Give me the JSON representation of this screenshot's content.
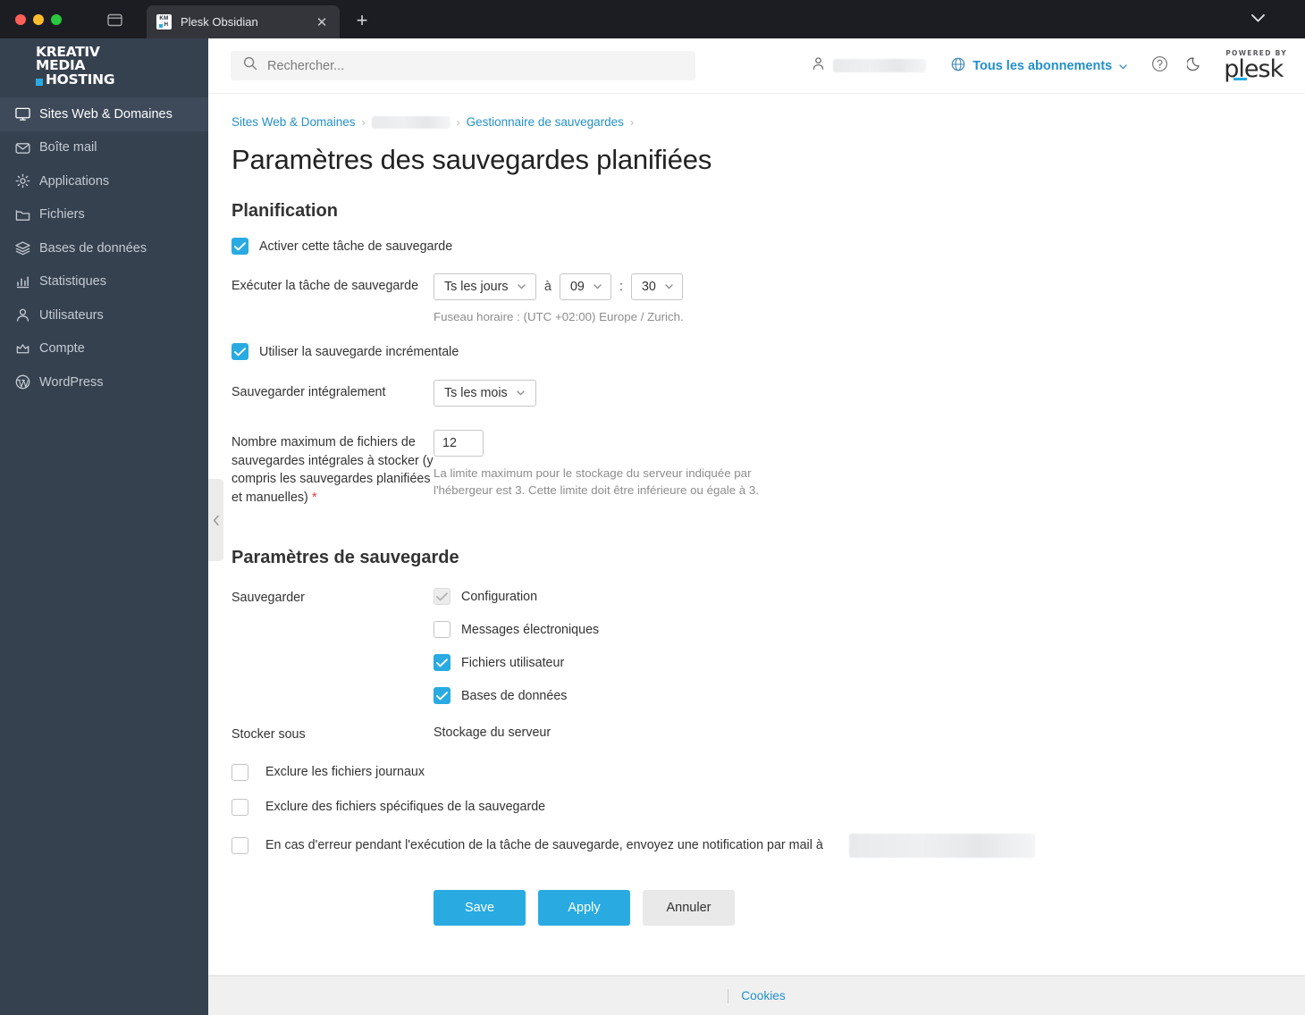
{
  "browser": {
    "tab_title": "Plesk Obsidian",
    "tab_favicon_top": "KM",
    "tab_favicon_bottom": "H",
    "close_glyph": "✕",
    "newtab_glyph": "+"
  },
  "sidebar": {
    "brand": {
      "line1": "KREATIV",
      "line2": "MEDIA",
      "line3": "HOSTING"
    },
    "items": [
      {
        "label": "Sites Web & Domaines",
        "icon": "monitor-icon",
        "active": true
      },
      {
        "label": "Boîte mail",
        "icon": "mail-icon",
        "active": false
      },
      {
        "label": "Applications",
        "icon": "gear-icon",
        "active": false
      },
      {
        "label": "Fichiers",
        "icon": "folder-icon",
        "active": false
      },
      {
        "label": "Bases de données",
        "icon": "database-icon",
        "active": false
      },
      {
        "label": "Statistiques",
        "icon": "chart-icon",
        "active": false
      },
      {
        "label": "Utilisateurs",
        "icon": "user-icon",
        "active": false
      },
      {
        "label": "Compte",
        "icon": "crown-icon",
        "active": false
      },
      {
        "label": "WordPress",
        "icon": "wordpress-icon",
        "active": false
      }
    ]
  },
  "topbar": {
    "search_placeholder": "Rechercher...",
    "search_value": "",
    "subscriptions_label": "Tous les abonnements",
    "plesk_powered_by": "POWERED BY",
    "plesk_word": "plesk"
  },
  "breadcrumb": {
    "items": [
      {
        "label": "Sites Web & Domaines",
        "redacted": false
      },
      {
        "label": "",
        "redacted": true
      },
      {
        "label": "Gestionnaire de sauvegardes",
        "redacted": false
      }
    ],
    "separator": "›"
  },
  "page": {
    "title": "Paramètres des sauvegardes planifiées",
    "section_schedule": "Planification",
    "section_backup_settings": "Paramètres de sauvegarde"
  },
  "schedule": {
    "enable_label": "Activer cette tâche de sauvegarde",
    "enable_checked": true,
    "run_task_label": "Exécuter la tâche de sauvegarde",
    "frequency_value": "Ts les jours",
    "at_label": "à",
    "hour_value": "09",
    "time_separator": ":",
    "minute_value": "30",
    "timezone_hint": "Fuseau horaire : (UTC +02:00) Europe / Zurich.",
    "incremental_label": "Utiliser la sauvegarde incrémentale",
    "incremental_checked": true,
    "full_backup_label": "Sauvegarder intégralement",
    "full_backup_value": "Ts les mois",
    "max_files_label": "Nombre maximum de fichiers de sauvegardes intégrales à stocker (y compris les sauvegardes planifiées et manuelles)",
    "max_files_required_mark": "*",
    "max_files_value": "12",
    "max_files_hint": "La limite maximum pour le stockage du serveur indiquée par l'hébergeur est 3. Cette limite doit être inférieure ou égale à 3."
  },
  "backup_settings": {
    "backup_label": "Sauvegarder",
    "options": [
      {
        "label": "Configuration",
        "checked": true,
        "disabled": true
      },
      {
        "label": "Messages électroniques",
        "checked": false,
        "disabled": false
      },
      {
        "label": "Fichiers utilisateur",
        "checked": true,
        "disabled": false
      },
      {
        "label": "Bases de données",
        "checked": true,
        "disabled": false
      }
    ],
    "store_in_label": "Stocker sous",
    "store_in_value": "Stockage du serveur",
    "exclude_logs_label": "Exclure les fichiers journaux",
    "exclude_logs_checked": false,
    "exclude_specific_label": "Exclure des fichiers spécifiques de la sauvegarde",
    "exclude_specific_checked": false,
    "notify_label": "En cas d'erreur pendant l'exécution de la tâche de sauvegarde, envoyez une notification par mail à",
    "notify_checked": false,
    "notify_email_value": ""
  },
  "buttons": {
    "save": "Save",
    "apply": "Apply",
    "cancel": "Annuler"
  },
  "footer": {
    "cookies_label": "Cookies"
  },
  "colors": {
    "accent": "#29abe2",
    "sidebar_bg": "#364150",
    "sidebar_active": "#3e4a5a",
    "link": "#2390c8",
    "required": "#e0414a"
  }
}
